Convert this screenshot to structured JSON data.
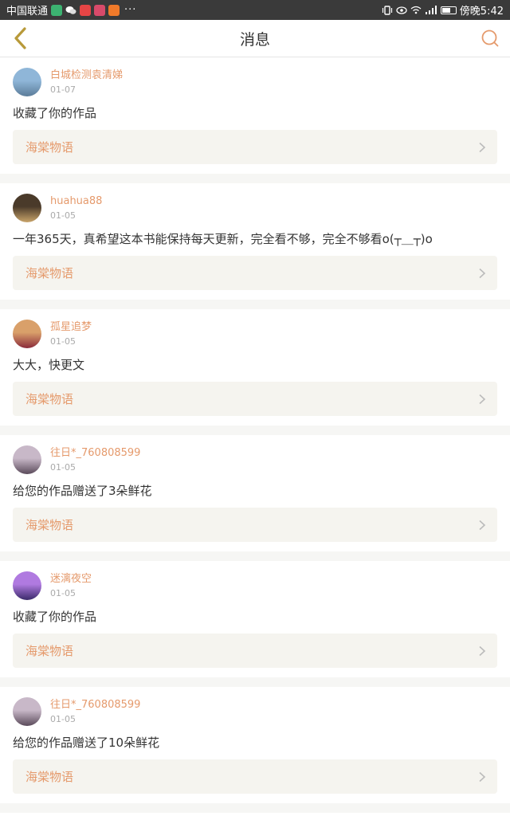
{
  "status_bar": {
    "carrier": "中国联通",
    "dots": "···",
    "time": "傍晚5:42",
    "app_icons": [
      {
        "name": "video-app-icon",
        "color": "#3cb371"
      },
      {
        "name": "wechat-icon",
        "color": "#ffffff"
      },
      {
        "name": "red-app-icon",
        "color": "#e64545"
      },
      {
        "name": "gallery-app-icon",
        "color": "#d84a6a"
      },
      {
        "name": "play-app-icon",
        "color": "#f07a2a"
      }
    ]
  },
  "navbar": {
    "title": "消息",
    "accent": "#e59a6c",
    "back_color": "#b89a3a"
  },
  "messages": [
    {
      "user": "白城检测袁清娣",
      "date": "01-07",
      "text": "收藏了你的作品",
      "work": "海棠物语",
      "avatar": {
        "top": "#8fb6d8",
        "bottom": "#5b7c99"
      }
    },
    {
      "user": "huahua88",
      "date": "01-05",
      "text": "一年365天，真希望这本书能保持每天更新，完全看不够，完全不够看o(┬＿┬)o",
      "work": "海棠物语",
      "avatar": {
        "top": "#4a3a2a",
        "bottom": "#c9a46a"
      }
    },
    {
      "user": "孤星追梦",
      "date": "01-05",
      "text": "大大，快更文",
      "work": "海棠物语",
      "avatar": {
        "top": "#d9a06a",
        "bottom": "#8a2a3a"
      }
    },
    {
      "user": "往日*_760808599",
      "date": "01-05",
      "text": "给您的作品赠送了3朵鲜花",
      "work": "海棠物语",
      "avatar": {
        "top": "#c8b8c8",
        "bottom": "#5a4a5a"
      }
    },
    {
      "user": "迷漓夜空",
      "date": "01-05",
      "text": "收藏了你的作品",
      "work": "海棠物语",
      "avatar": {
        "top": "#b07ae0",
        "bottom": "#3a2a6a"
      }
    },
    {
      "user": "往日*_760808599",
      "date": "01-05",
      "text": "给您的作品赠送了10朵鲜花",
      "work": "海棠物语",
      "avatar": {
        "top": "#c8b8c8",
        "bottom": "#5a4a5a"
      }
    }
  ]
}
